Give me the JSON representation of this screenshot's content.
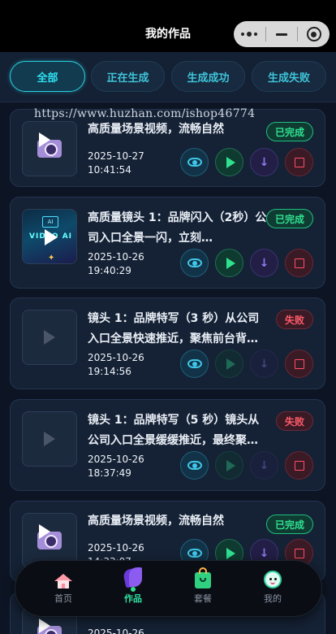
{
  "header": {
    "title": "我的作品"
  },
  "tabs": [
    {
      "label": "全部",
      "active": true
    },
    {
      "label": "正在生成",
      "active": false
    },
    {
      "label": "生成成功",
      "active": false
    },
    {
      "label": "生成失败",
      "active": false
    }
  ],
  "watermark": "https://www.huzhan.com/ishop46774",
  "works": [
    {
      "title": "高质量场景视频，流畅自然",
      "date": "2025-10-27",
      "time": "10:41:54",
      "status": "已完成",
      "status_type": "done",
      "thumb": "video-icon"
    },
    {
      "title": "高质量镜头 1：品牌闪入（2秒）公司入口全景一闪，立刻…",
      "date": "2025-10-26",
      "time": "19:40:29",
      "status": "已完成",
      "status_type": "done",
      "thumb": "ai-cover",
      "thumb_text": "VIDEO AI",
      "chip_text": "AI"
    },
    {
      "title": "镜头 1：品牌特写（3 秒）从公司入口全景快速推近，聚焦前台背…",
      "date": "2025-10-26",
      "time": "19:14:56",
      "status": "失败",
      "status_type": "fail",
      "thumb": "placeholder"
    },
    {
      "title": "镜头 1：品牌特写（5 秒）镜头从公司入口全景缓缓推近，最终聚…",
      "date": "2025-10-26",
      "time": "18:37:49",
      "status": "失败",
      "status_type": "fail",
      "thumb": "placeholder"
    },
    {
      "title": "高质量场景视频，流畅自然",
      "date": "2025-10-26",
      "time": "14:33:07",
      "status": "已完成",
      "status_type": "done",
      "thumb": "video-icon"
    },
    {
      "title": "",
      "date": "2025-10-26",
      "time": "",
      "status": "",
      "status_type": "done",
      "thumb": "video-icon"
    }
  ],
  "actions": {
    "view": "eye-icon",
    "play": "play-icon",
    "download": "download-icon",
    "stop": "stop-icon"
  },
  "nav": [
    {
      "label": "首页",
      "icon": "home-icon",
      "active": false
    },
    {
      "label": "作品",
      "icon": "works-icon",
      "active": true
    },
    {
      "label": "套餐",
      "icon": "package-bag-icon",
      "active": false
    },
    {
      "label": "我的",
      "icon": "profile-icon",
      "active": false
    }
  ],
  "colors": {
    "accent": "#2fe0f0",
    "success": "#2fe08f",
    "fail": "#ff5a6a",
    "background": "#0d1524"
  }
}
